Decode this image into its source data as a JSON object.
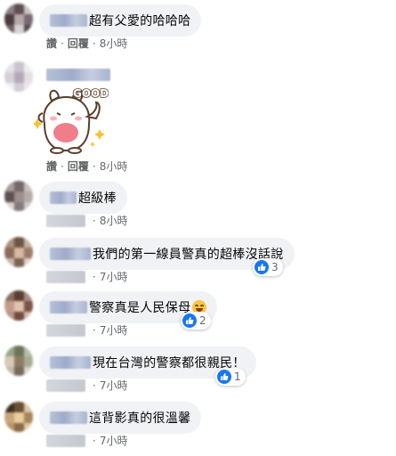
{
  "colors": {
    "bubble": "#f0f2f5",
    "like_blue": "#1877f2",
    "meta_gray": "#65676b",
    "text": "#050505"
  },
  "comments": [
    {
      "text": "超有父愛的哈哈哈",
      "actions": {
        "like": "讚",
        "reply": "回覆",
        "time": "8小時"
      }
    },
    {
      "sticker": "GOOD",
      "actions": {
        "like": "讚",
        "reply": "回覆",
        "time": "8小時"
      }
    },
    {
      "text": "超級棒",
      "actions": {
        "time": "8小時"
      }
    },
    {
      "text": "我們的第一線員警真的超棒沒話說",
      "reaction_count": "3",
      "actions": {
        "time": "7小時"
      }
    },
    {
      "text": "警察真是人民保母",
      "reaction_count": "2",
      "actions": {
        "time": "7小時"
      }
    },
    {
      "text": "現在台灣的警察都很親民！",
      "reaction_count": "1",
      "actions": {
        "time": "7小時"
      }
    },
    {
      "text": "這背影真的很溫馨",
      "actions": {
        "time": "7小時"
      }
    }
  ]
}
